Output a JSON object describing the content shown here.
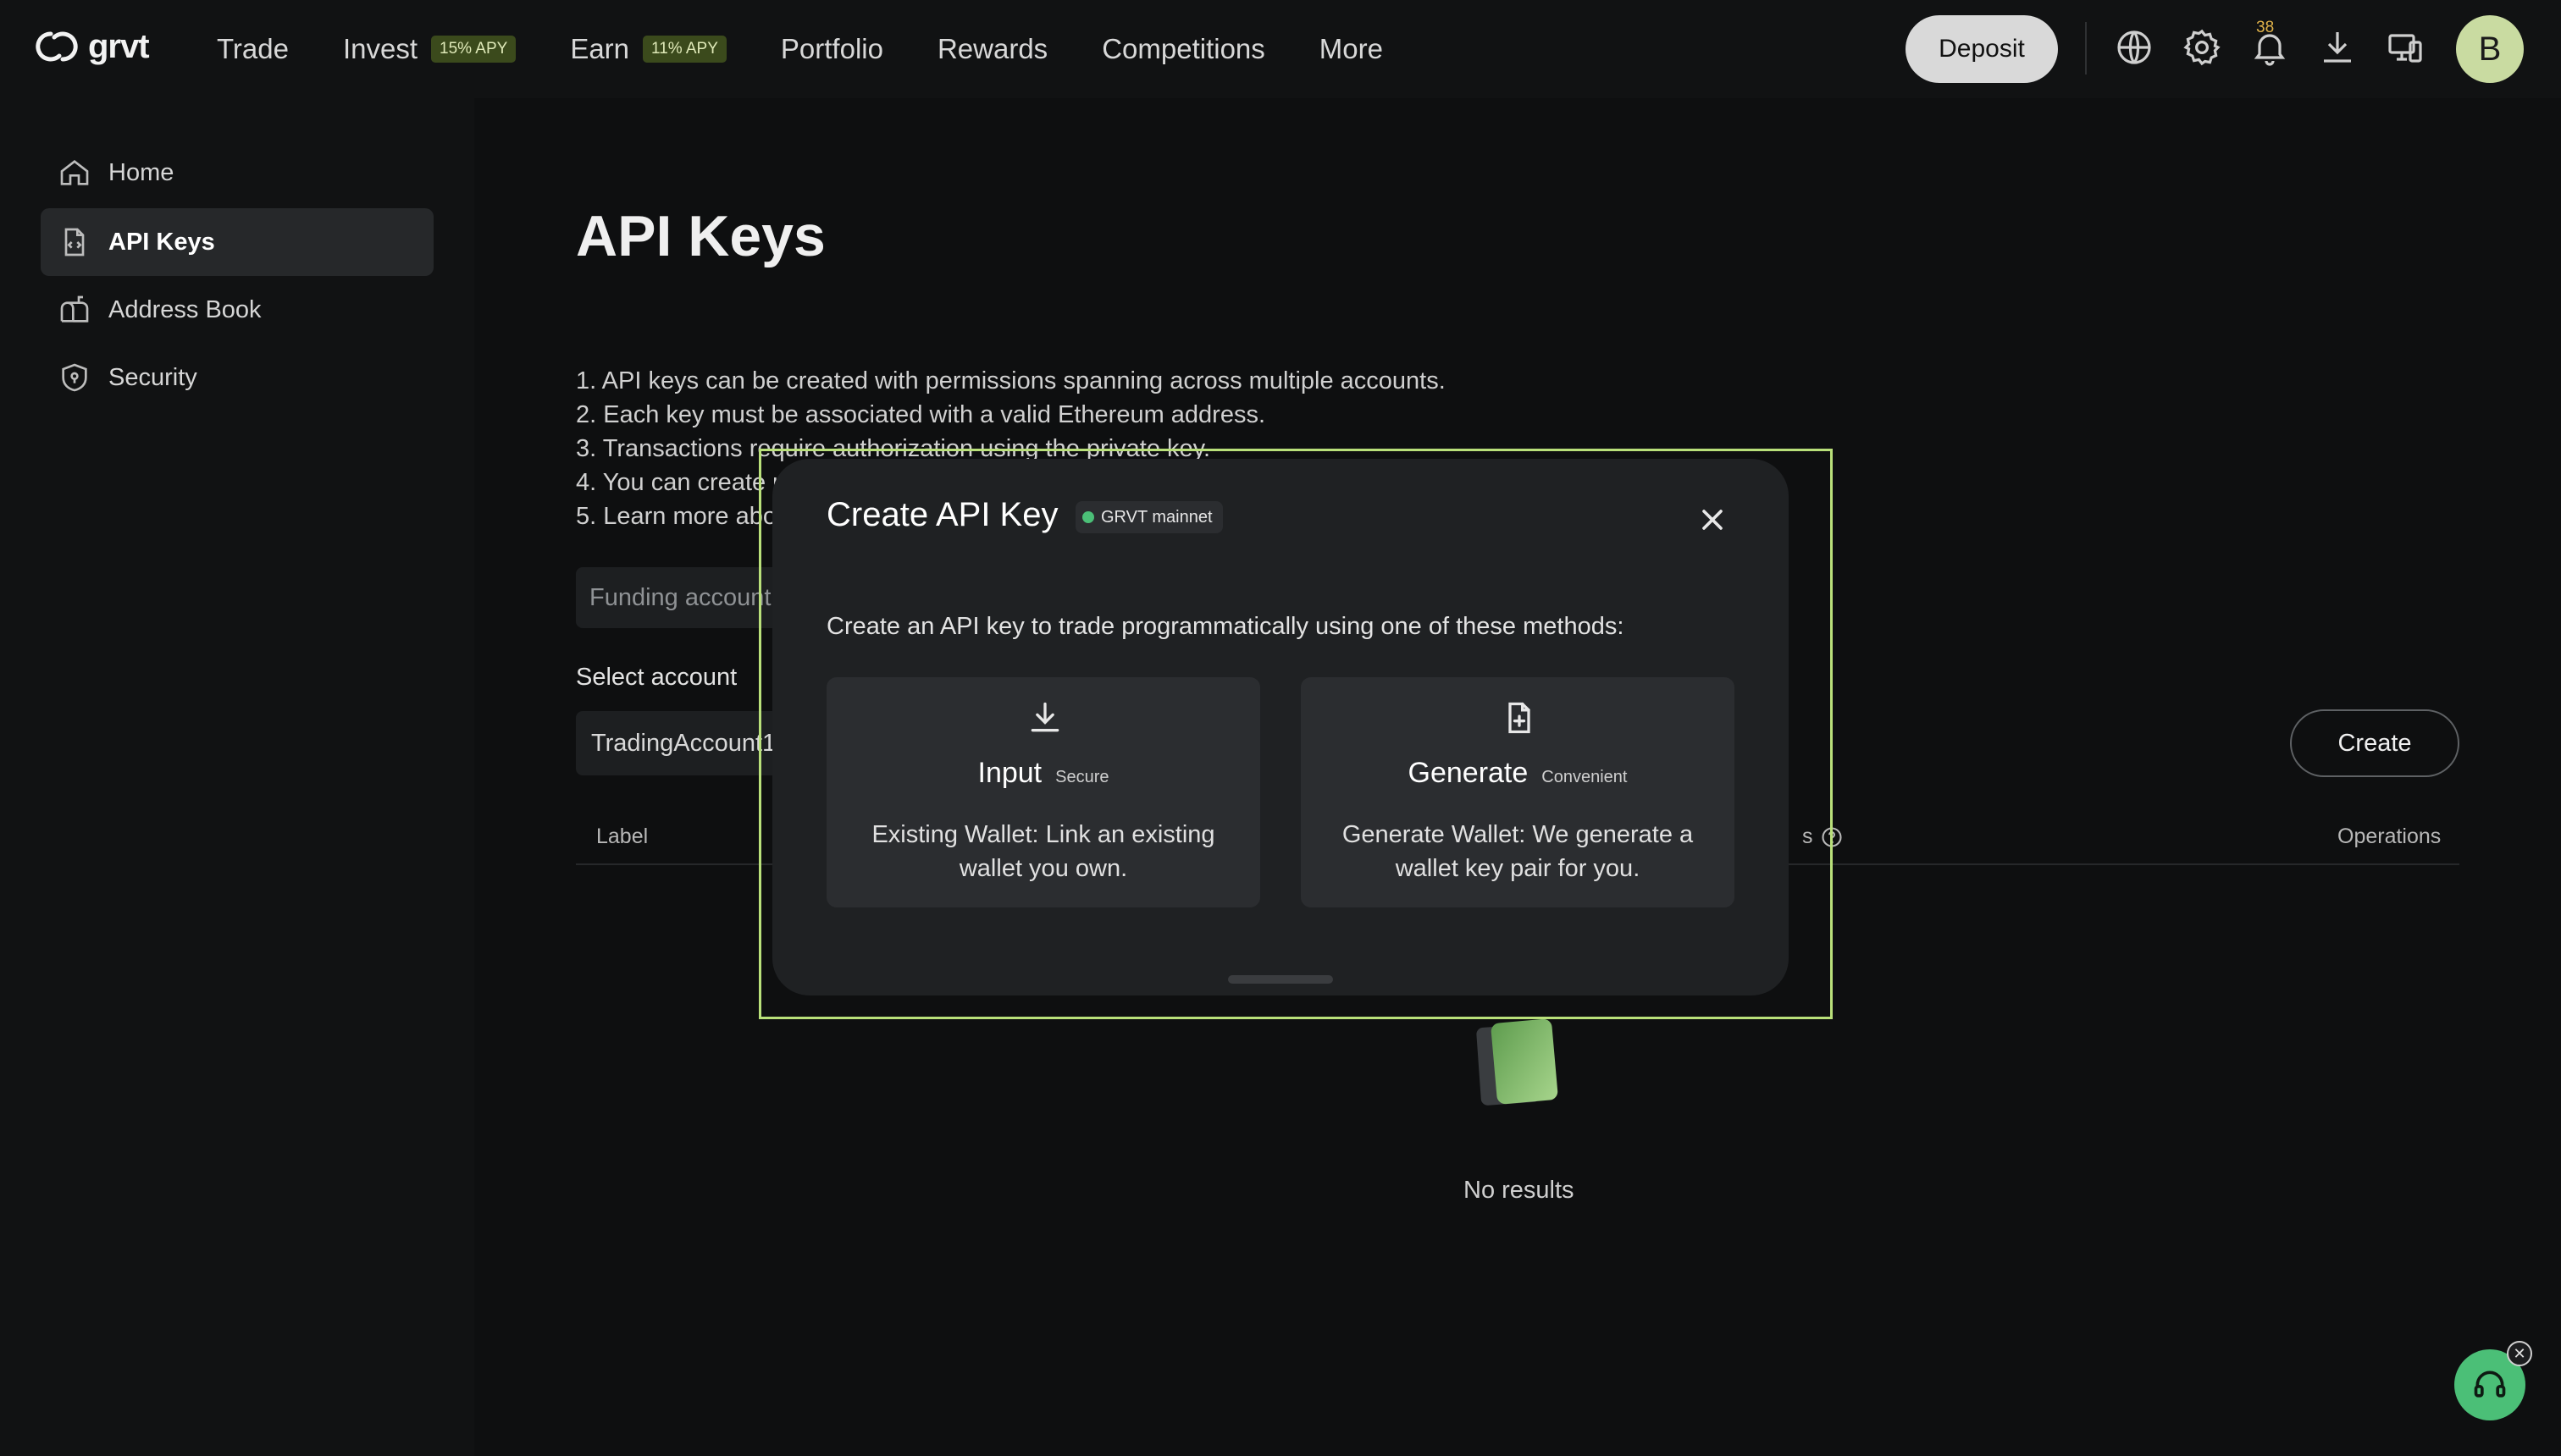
{
  "brand": {
    "name": "grvt"
  },
  "nav": {
    "items": [
      {
        "label": "Trade"
      },
      {
        "label": "Invest",
        "badge": "15% APY"
      },
      {
        "label": "Earn",
        "badge": "11% APY"
      },
      {
        "label": "Portfolio"
      },
      {
        "label": "Rewards"
      },
      {
        "label": "Competitions"
      },
      {
        "label": "More"
      }
    ],
    "deposit_label": "Deposit",
    "notification_count": "38",
    "avatar_initial": "B"
  },
  "sidebar": {
    "items": [
      {
        "label": "Home",
        "icon": "home-icon"
      },
      {
        "label": "API Keys",
        "icon": "document-code-icon",
        "active": true
      },
      {
        "label": "Address Book",
        "icon": "mailbox-icon"
      },
      {
        "label": "Security",
        "icon": "shield-icon"
      }
    ]
  },
  "main": {
    "title": "API Keys",
    "rules": [
      "1. API keys can be created with permissions spanning across multiple accounts.",
      "2. Each key must be associated with a valid Ethereum address.",
      "3. Transactions require authorization using the private key.",
      "4. You can create u",
      "5. Learn more abo"
    ],
    "funding_account": "Funding account",
    "select_account_label": "Select account",
    "selected_account": "TradingAccount1",
    "create_label": "Create",
    "table_headers": {
      "label": "Label",
      "permissions_suffix": "s",
      "operations": "Operations"
    },
    "empty_text": "No results"
  },
  "modal": {
    "title": "Create API Key",
    "network": "GRVT mainnet",
    "description": "Create an API key to trade programmatically using one of these methods:",
    "methods": [
      {
        "title": "Input",
        "tag": "Secure",
        "description": "Existing Wallet: Link an existing wallet you own.",
        "icon": "download-icon"
      },
      {
        "title": "Generate",
        "tag": "Convenient",
        "description": "Generate Wallet: We generate a wallet key pair for you.",
        "icon": "file-plus-icon"
      }
    ]
  },
  "colors": {
    "accent": "#b9e07a",
    "status_green": "#4bbf77",
    "badge_bg": "#3b4a1c"
  }
}
